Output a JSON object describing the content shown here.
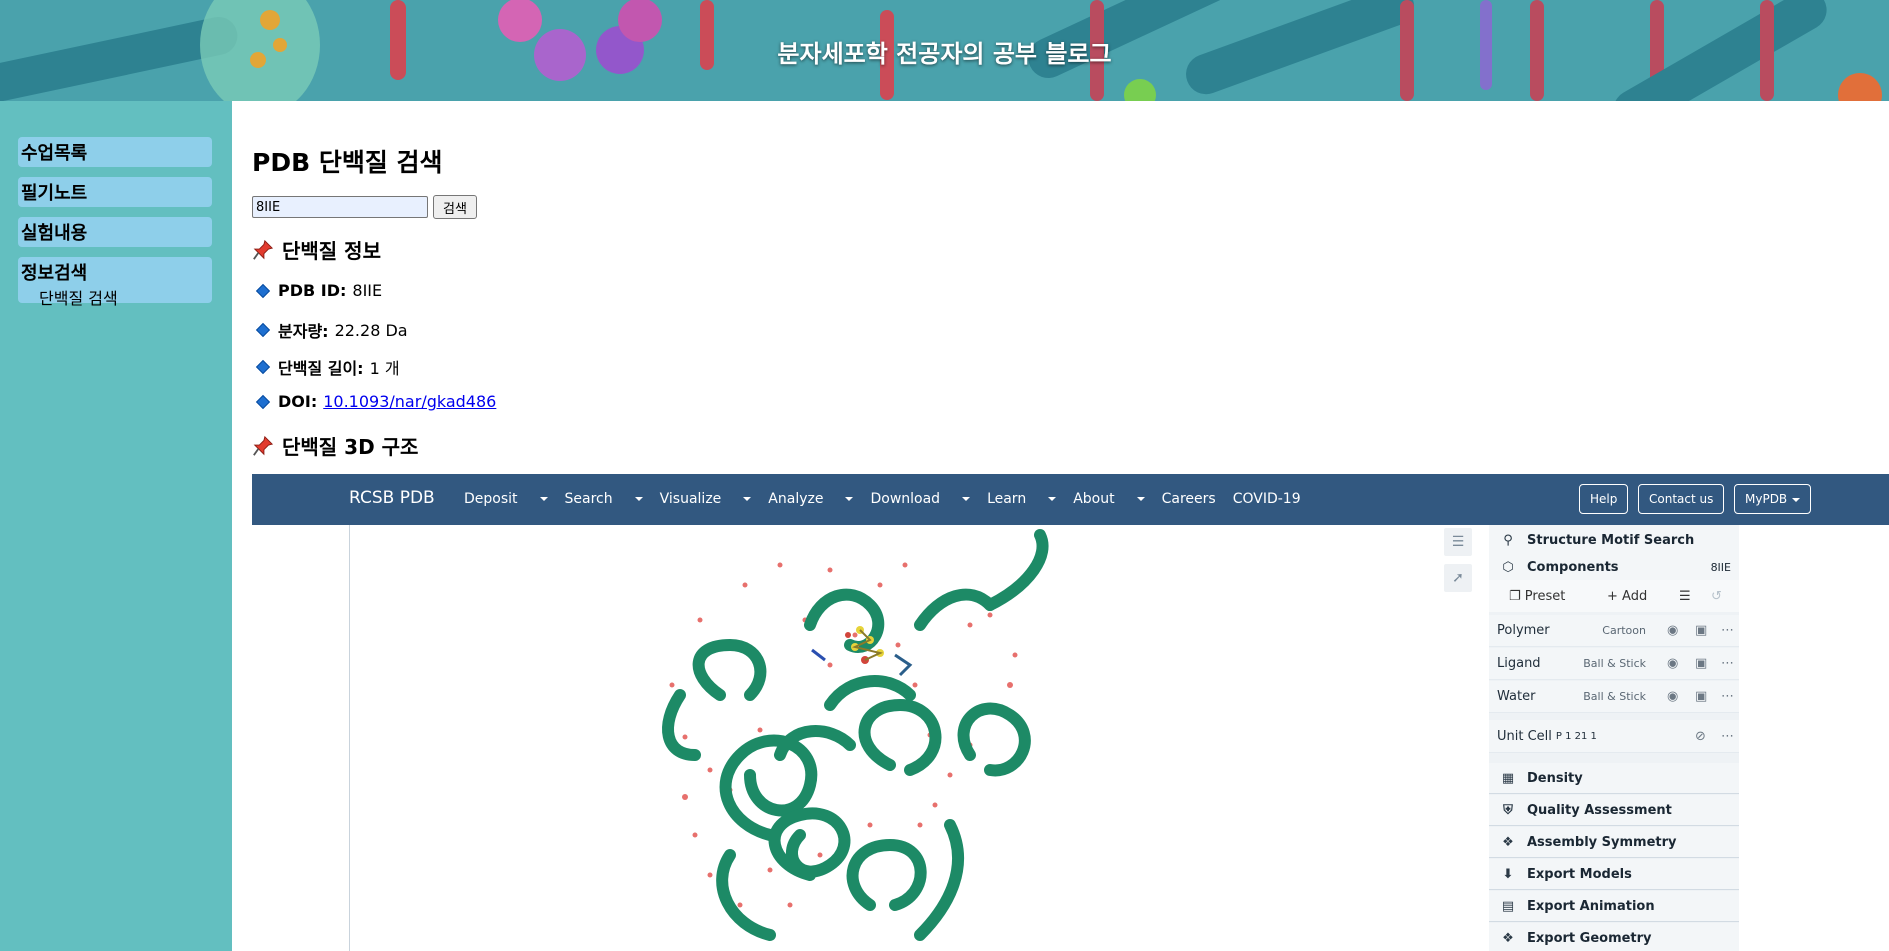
{
  "banner": {
    "title": "분자세포학 전공자의 공부 블로그"
  },
  "sidebar": {
    "items": [
      {
        "label": "수업목록"
      },
      {
        "label": "필기노트"
      },
      {
        "label": "실험내용"
      },
      {
        "label": "정보검색",
        "sub": "단백질 검색"
      }
    ]
  },
  "main": {
    "title": "PDB 단백질 검색",
    "search": {
      "value": "8IIE",
      "button": "검색"
    },
    "info_heading": "단백질 정보",
    "info": [
      {
        "label": "PDB ID:",
        "value": "8IIE"
      },
      {
        "label": "분자량:",
        "value": "22.28 Da"
      },
      {
        "label": "단백질 길이:",
        "value": "1 개"
      },
      {
        "label": "DOI:",
        "value": "10.1093/nar/gkad486"
      }
    ],
    "structure_heading": "단백질 3D 구조"
  },
  "rcsb": {
    "brand": "RCSB PDB",
    "menu": [
      "Deposit",
      "Search",
      "Visualize",
      "Analyze",
      "Download",
      "Learn",
      "About",
      "Careers",
      "COVID-19"
    ],
    "menu_dropdown": [
      true,
      true,
      true,
      true,
      true,
      true,
      true,
      false,
      false
    ],
    "buttons": [
      "Help",
      "Contact us",
      "MyPDB"
    ],
    "panel": {
      "motif": "Structure Motif Search",
      "components": "Components",
      "components_id": "8IIE",
      "preset": "Preset",
      "add": "Add",
      "rows": [
        {
          "name": "Polymer",
          "mode": "Cartoon"
        },
        {
          "name": "Ligand",
          "mode": "Ball & Stick"
        },
        {
          "name": "Water",
          "mode": "Ball & Stick"
        }
      ],
      "unit_cell": "Unit Cell",
      "unit_cell_group": "P 1 21 1",
      "sections": [
        "Density",
        "Quality Assessment",
        "Assembly Symmetry",
        "Export Models",
        "Export Animation",
        "Export Geometry"
      ]
    }
  },
  "colors": {
    "nav": "#325880",
    "sidebar": "#63bfc0",
    "sidebar_item": "#8ecfea",
    "protein": "#1d8a66"
  }
}
